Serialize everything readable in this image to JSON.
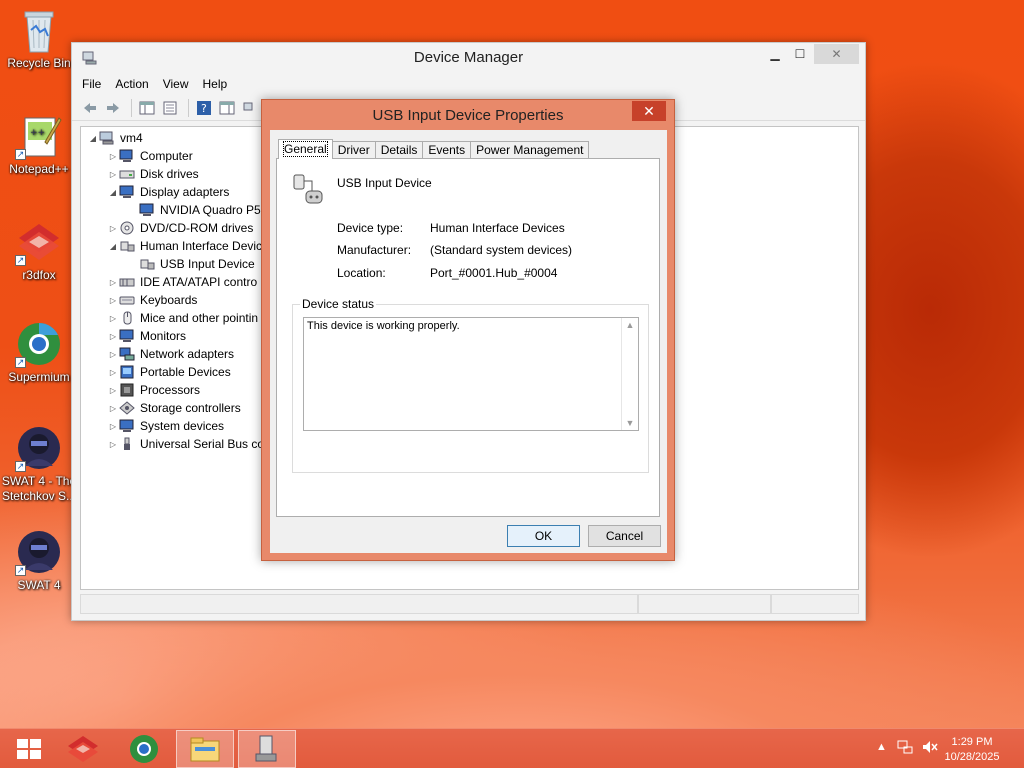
{
  "desktop": {
    "icons": [
      {
        "label": "Recycle Bin",
        "icon": "recycle-bin-icon"
      },
      {
        "label": "Notepad++",
        "icon": "notepad-plus-plus-icon"
      },
      {
        "label": "r3dfox",
        "icon": "r3dfox-icon"
      },
      {
        "label": "Supermium",
        "icon": "supermium-icon"
      },
      {
        "label": "SWAT 4 - The Stetchkov S...",
        "label_line1": "SWAT 4 - The",
        "label_line2": "Stetchkov S...",
        "icon": "swat4-expansion-icon"
      },
      {
        "label": "SWAT 4",
        "icon": "swat4-icon"
      }
    ]
  },
  "device_manager": {
    "title": "Device Manager",
    "menu": [
      "File",
      "Action",
      "View",
      "Help"
    ],
    "tree": {
      "root": "vm4",
      "items": [
        {
          "label": "Computer",
          "expanded": false
        },
        {
          "label": "Disk drives",
          "expanded": false
        },
        {
          "label": "Display adapters",
          "expanded": true
        },
        {
          "label": "NVIDIA Quadro P5",
          "child": true
        },
        {
          "label": "DVD/CD-ROM drives",
          "expanded": false
        },
        {
          "label": "Human Interface Devic",
          "expanded": true
        },
        {
          "label": "USB Input Device",
          "child": true
        },
        {
          "label": "IDE ATA/ATAPI contro",
          "expanded": false
        },
        {
          "label": "Keyboards",
          "expanded": false
        },
        {
          "label": "Mice and other pointin",
          "expanded": false
        },
        {
          "label": "Monitors",
          "expanded": false
        },
        {
          "label": "Network adapters",
          "expanded": false
        },
        {
          "label": "Portable Devices",
          "expanded": false
        },
        {
          "label": "Processors",
          "expanded": false
        },
        {
          "label": "Storage controllers",
          "expanded": false
        },
        {
          "label": "System devices",
          "expanded": false
        },
        {
          "label": "Universal Serial Bus co",
          "expanded": false
        }
      ]
    }
  },
  "properties_dialog": {
    "title": "USB Input Device Properties",
    "close_glyph": "✕",
    "tabs": [
      "General",
      "Driver",
      "Details",
      "Events",
      "Power Management"
    ],
    "active_tab": "General",
    "device_name": "USB Input Device",
    "fields": [
      {
        "label": "Device type:",
        "value": "Human Interface Devices"
      },
      {
        "label": "Manufacturer:",
        "value": "(Standard system devices)"
      },
      {
        "label": "Location:",
        "value": "Port_#0001.Hub_#0004"
      }
    ],
    "status_group_label": "Device status",
    "status_text": "This device is working properly.",
    "ok_label": "OK",
    "cancel_label": "Cancel"
  },
  "taskbar": {
    "time": "1:29 PM",
    "date": "10/28/2025"
  },
  "colors": {
    "desktop_orange": "#ee4f16",
    "taskbar": "#e25b3d",
    "dialog_frame": "#e8896a",
    "close_button": "#c7412a"
  }
}
